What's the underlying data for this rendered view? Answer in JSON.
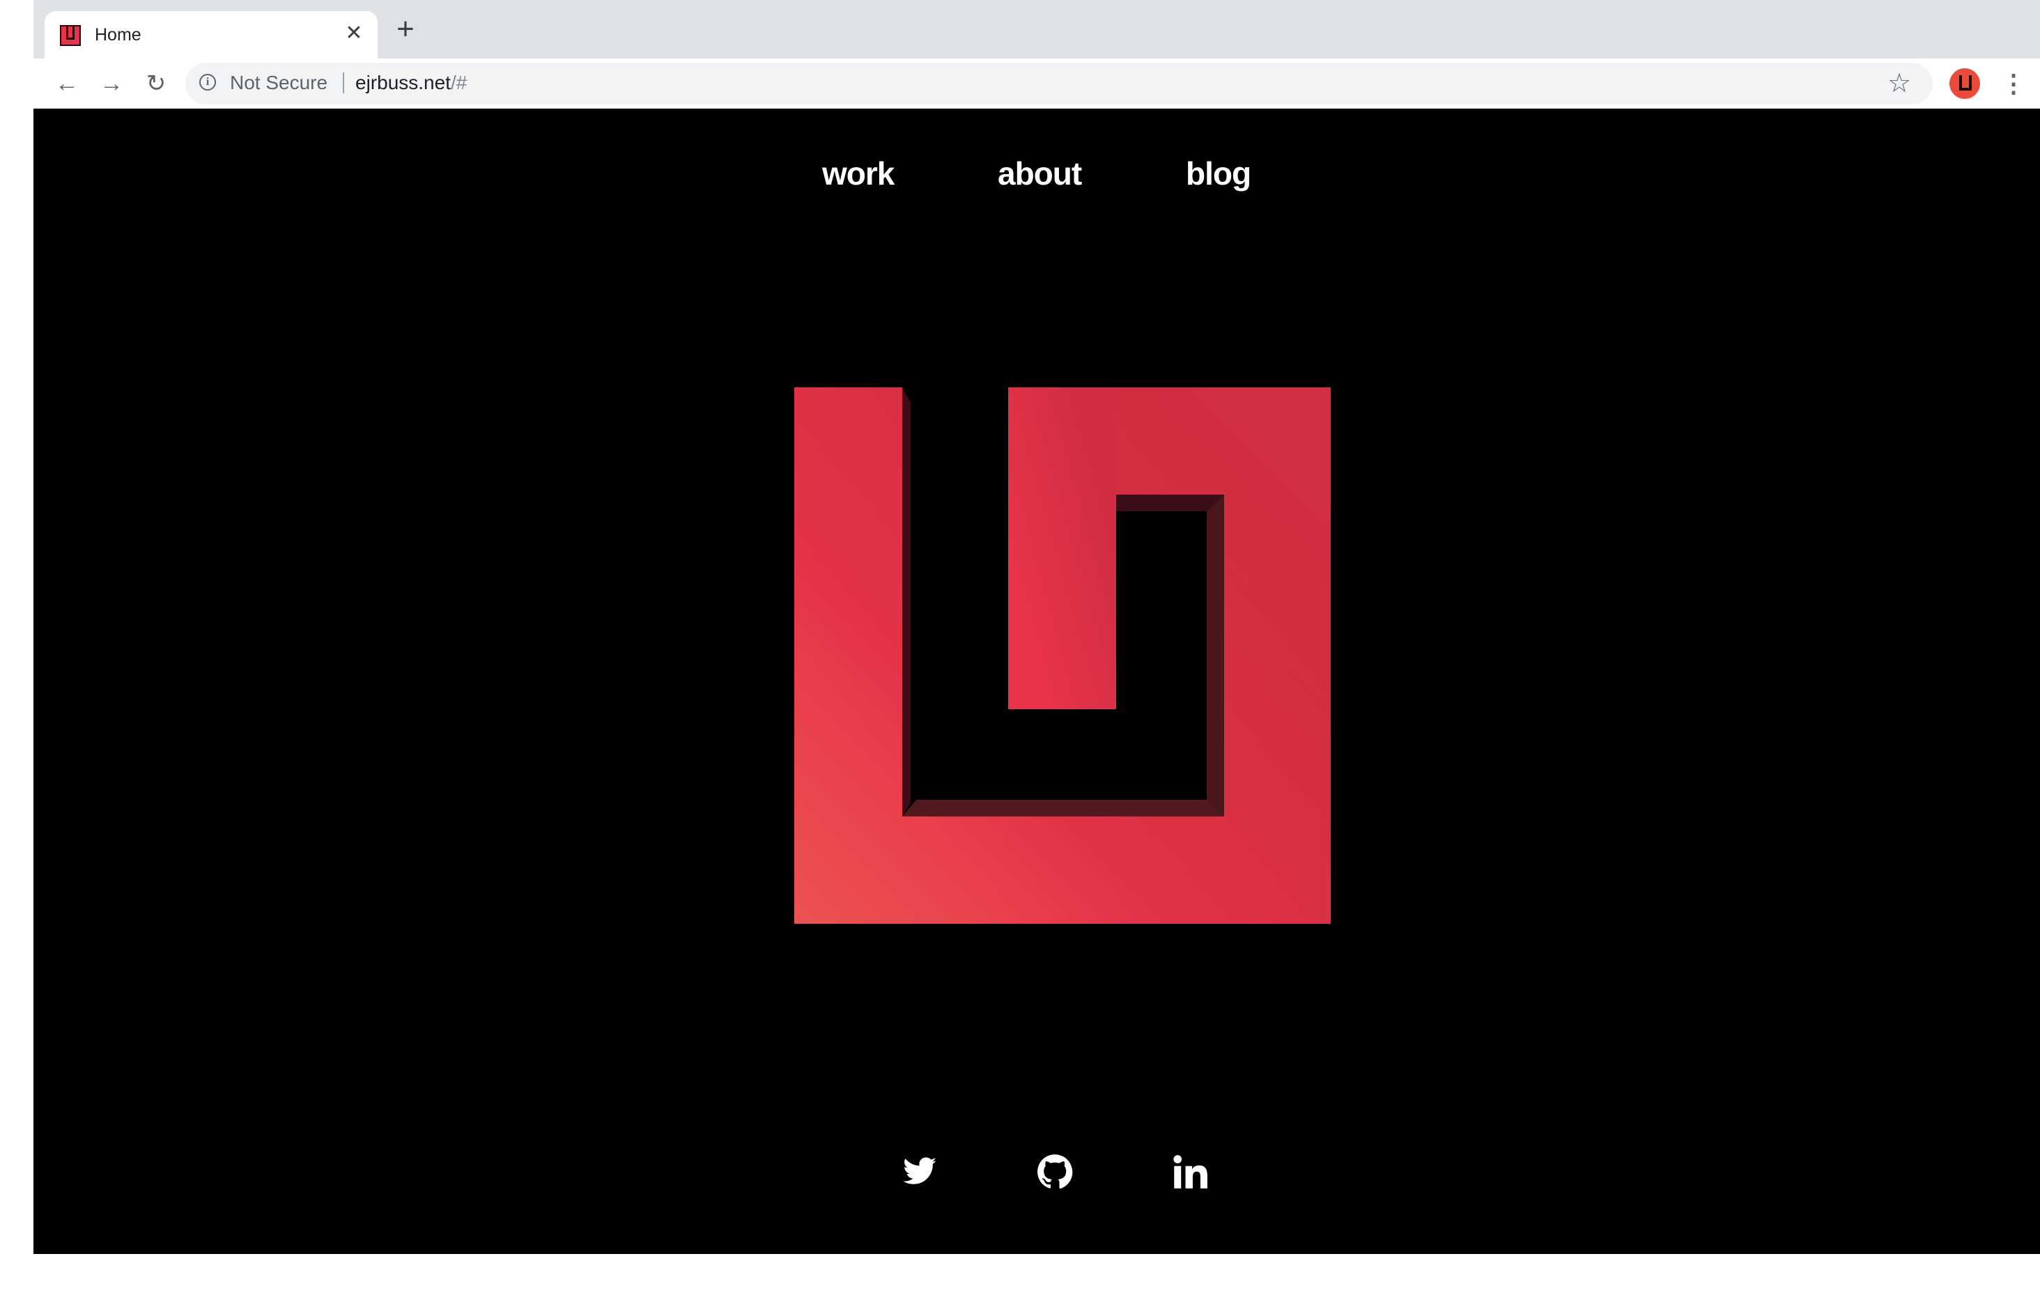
{
  "browser": {
    "tab": {
      "title": "Home",
      "close_glyph": "✕",
      "favicon": "site-logo-favicon"
    },
    "new_tab_glyph": "+",
    "back_glyph": "←",
    "forward_glyph": "→",
    "reload_glyph": "↻",
    "info_glyph": "i",
    "security_label": "Not Secure",
    "url_host": "ejrbuss.net",
    "url_path": "/#",
    "star_glyph": "☆",
    "menu_glyph": "⋮"
  },
  "site": {
    "nav": [
      {
        "label": "work"
      },
      {
        "label": "about"
      },
      {
        "label": "blog"
      }
    ],
    "logo": {
      "colors": {
        "light": "#e94a4f",
        "main": "#e8334a",
        "dark": "#d42a3c",
        "inner": "#521a1f"
      }
    },
    "social": [
      {
        "icon": "twitter-icon"
      },
      {
        "icon": "github-icon"
      },
      {
        "icon": "linkedin-icon"
      }
    ]
  },
  "colors": {
    "page_background": "#000000",
    "nav_text": "#ffffff",
    "chrome_tabstrip": "#dee1e6"
  }
}
